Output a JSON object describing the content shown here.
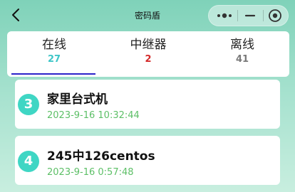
{
  "nav": {
    "title": "密码盾",
    "back_icon": "chevron-left-icon"
  },
  "capsule": {
    "more_icon": "more-dots-icon",
    "minimize_icon": "minimize-icon",
    "close_icon": "target-icon"
  },
  "tabs": [
    {
      "label": "在线",
      "count": "27",
      "color": "#3fc6c8",
      "active": true
    },
    {
      "label": "中继器",
      "count": "2",
      "color": "#d42a2a",
      "active": false
    },
    {
      "label": "离线",
      "count": "41",
      "color": "#7a7a7a",
      "active": false
    }
  ],
  "devices": [
    {
      "badge": "3",
      "name": "家里台式机",
      "time": "2023-9-16 10:32:44"
    },
    {
      "badge": "4",
      "name": "245中126centos",
      "time": "2023-9-16 0:57:48"
    }
  ]
}
